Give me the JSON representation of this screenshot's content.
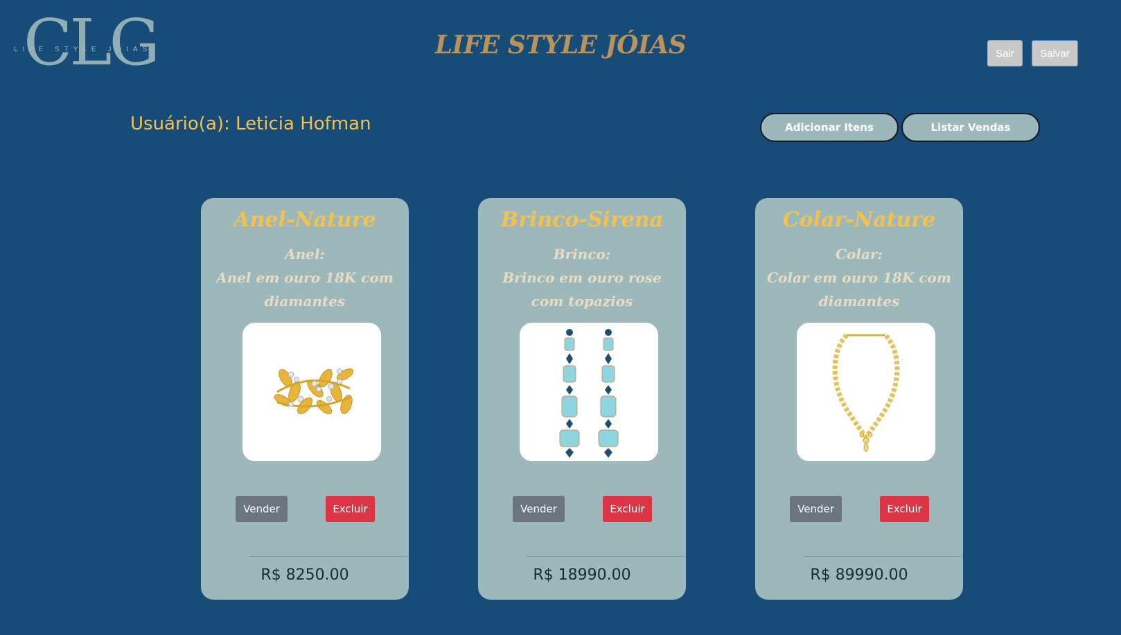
{
  "logo": {
    "letters": "CLG",
    "subtitle": "LIFE STYLE JÓIAS"
  },
  "header": {
    "title": "LIFE STYLE JÓIAS",
    "logout_label": "Sair",
    "save_label": "Salvar"
  },
  "user": {
    "label": "Usuário(a): Leticia Hofman"
  },
  "actions": {
    "add_items": "Adicionar Itens",
    "list_sales": "Listar Vendas"
  },
  "products": [
    {
      "name": "Anel-Nature",
      "category": "Anel:",
      "description": "Anel em ouro 18K com diamantes",
      "image_icon": "gold-leaf-ring",
      "sell_label": "Vender",
      "delete_label": "Excluir",
      "price": "R$ 8250.00"
    },
    {
      "name": "Brinco-Sirena",
      "category": "Brinco:",
      "description": "Brinco em ouro rose com topazios",
      "image_icon": "blue-topaz-earrings",
      "sell_label": "Vender",
      "delete_label": "Excluir",
      "price": "R$ 18990.00"
    },
    {
      "name": "Colar-Nature",
      "category": "Colar:",
      "description": "Colar em ouro 18K com diamantes",
      "image_icon": "gold-necklace",
      "sell_label": "Vender",
      "delete_label": "Excluir",
      "price": "R$ 89990.00"
    }
  ],
  "colors": {
    "background": "#174b78",
    "card": "#9db8ba",
    "accent_gold": "#f2c14e",
    "title_gold": "#b9935a",
    "danger": "#dc3545",
    "secondary": "#6c757d"
  }
}
